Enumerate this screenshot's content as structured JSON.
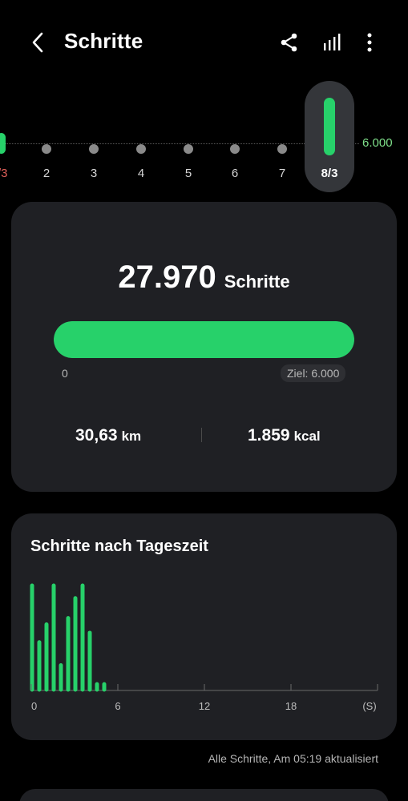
{
  "header": {
    "title": "Schritte",
    "back_icon": "arrow-left-icon",
    "share_icon": "share-icon",
    "stats_icon": "bar-chart-icon",
    "more_icon": "more-vertical-icon"
  },
  "day_strip": {
    "prev_label": "/3",
    "days": [
      "2",
      "3",
      "4",
      "5",
      "6",
      "7"
    ],
    "selected_label": "8/3",
    "goal_label": "6.000"
  },
  "summary": {
    "steps_value": "27.970",
    "steps_unit": "Schritte",
    "progress_fraction": 1.0,
    "progress_start": "0",
    "goal_text": "Ziel: 6.000",
    "distance_value": "30,63",
    "distance_unit": "km",
    "energy_value": "1.859",
    "energy_unit": "kcal"
  },
  "chart_data": {
    "type": "bar",
    "title": "Schritte nach Tageszeit",
    "x_ticks": [
      "0",
      "6",
      "12",
      "18",
      "(S)"
    ],
    "xlim": [
      0,
      24
    ],
    "x": [
      0,
      0.5,
      1,
      1.5,
      2,
      2.5,
      3,
      3.5,
      4,
      4.5,
      5
    ],
    "values": [
      100,
      46,
      63,
      100,
      24,
      69,
      88,
      100,
      55,
      6,
      6
    ],
    "ylim": [
      0,
      100
    ],
    "color": "#27d16a"
  },
  "footer": {
    "note": "Alle Schritte, Am 05:19 aktualisiert"
  },
  "colors": {
    "accent": "#27d16a",
    "background": "#000000",
    "card": "#1f2024",
    "prev_day": "#e0605a"
  }
}
